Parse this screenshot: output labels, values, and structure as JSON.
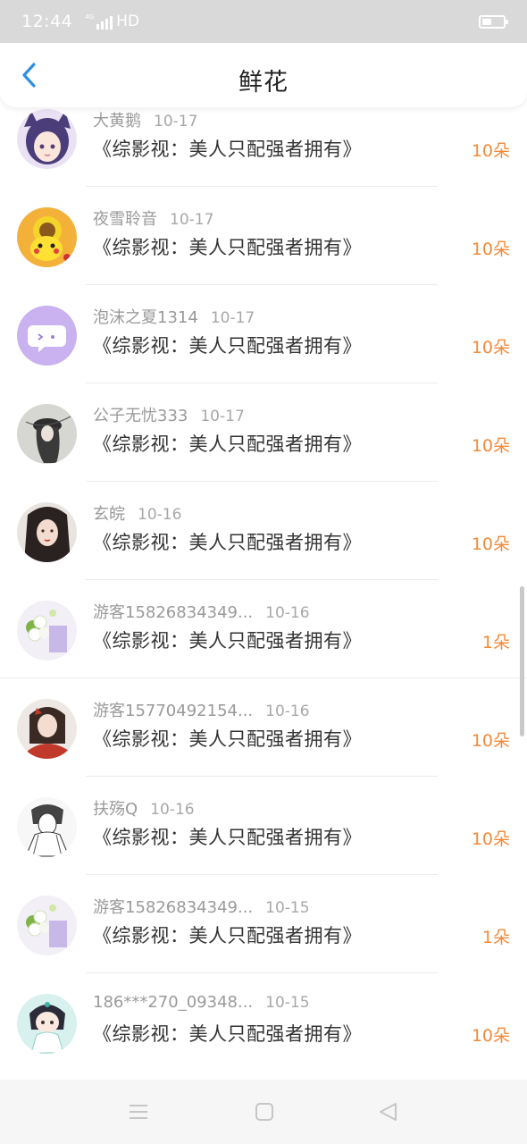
{
  "status_bar": {
    "time": "12:44",
    "network_small": "4G",
    "hd": "HD"
  },
  "header": {
    "title": "鲜花"
  },
  "colors": {
    "accent_blue": "#2f8fe0",
    "count_orange": "#f28a3a"
  },
  "rows": [
    {
      "user": "大黄鹅",
      "date": "10-17",
      "book": "《综影视：美人只配强者拥有》",
      "count": "10朵",
      "avatar": "anime-girl-cat-ears"
    },
    {
      "user": "夜雪聆音",
      "date": "10-17",
      "book": "《综影视：美人只配强者拥有》",
      "count": "10朵",
      "avatar": "pikachu-sunflower"
    },
    {
      "user": "泡沫之夏1314",
      "date": "10-17",
      "book": "《综影视：美人只配强者拥有》",
      "count": "10朵",
      "avatar": "purple-chat-bubble"
    },
    {
      "user": "公子无忧333",
      "date": "10-17",
      "book": "《综影视：美人只配强者拥有》",
      "count": "10朵",
      "avatar": "ink-swordsman"
    },
    {
      "user": "玄皖",
      "date": "10-16",
      "book": "《综影视：美人只配强者拥有》",
      "count": "10朵",
      "avatar": "dark-hair-woman"
    },
    {
      "user": "游客15826834349...",
      "date": "10-16",
      "book": "《综影视：美人只配强者拥有》",
      "count": "1朵",
      "avatar": "white-flowers"
    },
    {
      "user": "游客15770492154...",
      "date": "10-16",
      "book": "《综影视：美人只配强者拥有》",
      "count": "10朵",
      "avatar": "girl-red-bow"
    },
    {
      "user": "扶殇Q",
      "date": "10-16",
      "book": "《综影视：美人只配强者拥有》",
      "count": "10朵",
      "avatar": "sketch-ancient-man"
    },
    {
      "user": "游客15826834349...",
      "date": "10-15",
      "book": "《综影视：美人只配强者拥有》",
      "count": "1朵",
      "avatar": "white-flowers"
    },
    {
      "user": "186***270_09348...",
      "date": "10-15",
      "book": "《综影视：美人只配强者拥有》",
      "count": "10朵",
      "avatar": "chibi-ancient-boy"
    }
  ],
  "nav": {
    "items": [
      "menu-icon",
      "home-icon",
      "back-icon"
    ]
  }
}
